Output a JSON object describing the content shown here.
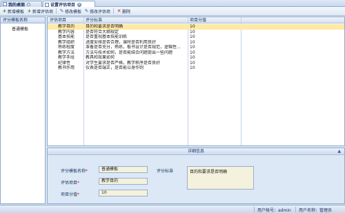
{
  "tabs": [
    {
      "label": "我的桌面",
      "active": false
    },
    {
      "label": "设置评估项目",
      "active": true
    }
  ],
  "toolbar": {
    "add_template": "新增模板",
    "add_item": "新增评估项",
    "edit_template": "修改模板",
    "edit_item": "修改评估项",
    "delete": "删除"
  },
  "left": {
    "header": "评分模板名称",
    "items": [
      "普通模板"
    ]
  },
  "grid": {
    "columns": [
      "评估项目",
      "评分标准",
      "项目分值"
    ],
    "rows": [
      {
        "item": "教学目的",
        "standard": "目的和要求是否明确",
        "score": "10",
        "selected": true
      },
      {
        "item": "教学内容",
        "standard": "是否符合大纲规定",
        "score": "10"
      },
      {
        "item": "基本技能",
        "standard": "是否重视基本技能训练",
        "score": "10"
      },
      {
        "item": "教学组织",
        "standard": "进度安排是否合理，课时是否利用良好",
        "score": "10"
      },
      {
        "item": "熟练程度",
        "standard": "准备是否充分，熟练，板书设计是否规范，逻辑性…",
        "score": "10"
      },
      {
        "item": "教学方法",
        "standard": "方法与技术如何，是否能结合问题提出一些问题",
        "score": "10"
      },
      {
        "item": "教学手段",
        "standard": "教具和效果如何",
        "score": "10"
      },
      {
        "item": "纪律性",
        "standard": "对学生要求是否严格，教学秩序是否良好",
        "score": "10"
      },
      {
        "item": "教书作用",
        "standard": "仪表是否端正，是否能以身作则",
        "score": "10"
      }
    ]
  },
  "detail": {
    "title": "详细信息",
    "template_label": "评分模板名称",
    "template_value": "普通模板",
    "item_label": "评估项目",
    "item_value": "教学目的",
    "score_label": "项目分值",
    "score_value": "10",
    "standard_label": "评分标准",
    "standard_value": "目的和要求是否明确",
    "required_mark": "*"
  },
  "status": {
    "account": "用户帐号：admin",
    "username": "用户名称：管理员"
  }
}
